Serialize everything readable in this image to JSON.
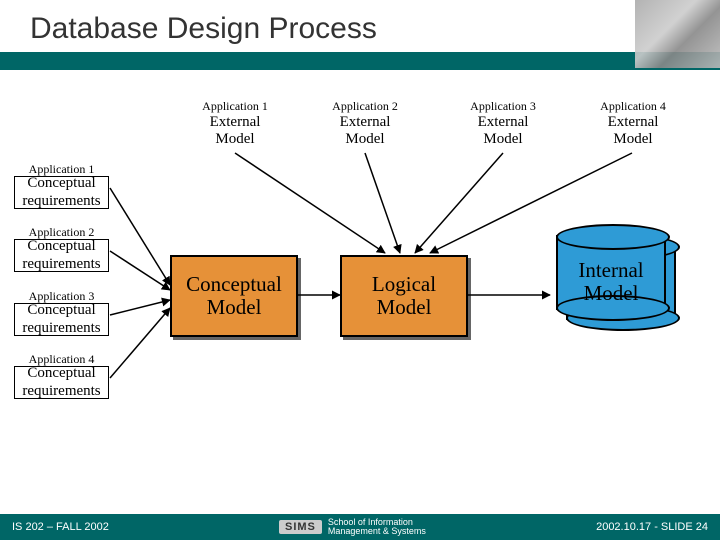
{
  "title": "Database Design Process",
  "external": [
    {
      "app": "Application 1",
      "l1": "External",
      "l2": "Model"
    },
    {
      "app": "Application 2",
      "l1": "External",
      "l2": "Model"
    },
    {
      "app": "Application 3",
      "l1": "External",
      "l2": "Model"
    },
    {
      "app": "Application 4",
      "l1": "External",
      "l2": "Model"
    }
  ],
  "reqs": [
    {
      "app": "Application 1",
      "l1": "Conceptual",
      "l2": "requirements"
    },
    {
      "app": "Application 2",
      "l1": "Conceptual",
      "l2": "requirements"
    },
    {
      "app": "Application 3",
      "l1": "Conceptual",
      "l2": "requirements"
    },
    {
      "app": "Application 4",
      "l1": "Conceptual",
      "l2": "requirements"
    }
  ],
  "conceptual": {
    "l1": "Conceptual",
    "l2": "Model"
  },
  "logical": {
    "l1": "Logical",
    "l2": "Model"
  },
  "internal": {
    "l1": "Internal",
    "l2": "Model"
  },
  "footer": {
    "course": "IS 202 – FALL 2002",
    "sims": "SIMS",
    "sims_sub1": "School of Information",
    "sims_sub2": "Management & Systems",
    "slide": "2002.10.17 - SLIDE 24"
  }
}
